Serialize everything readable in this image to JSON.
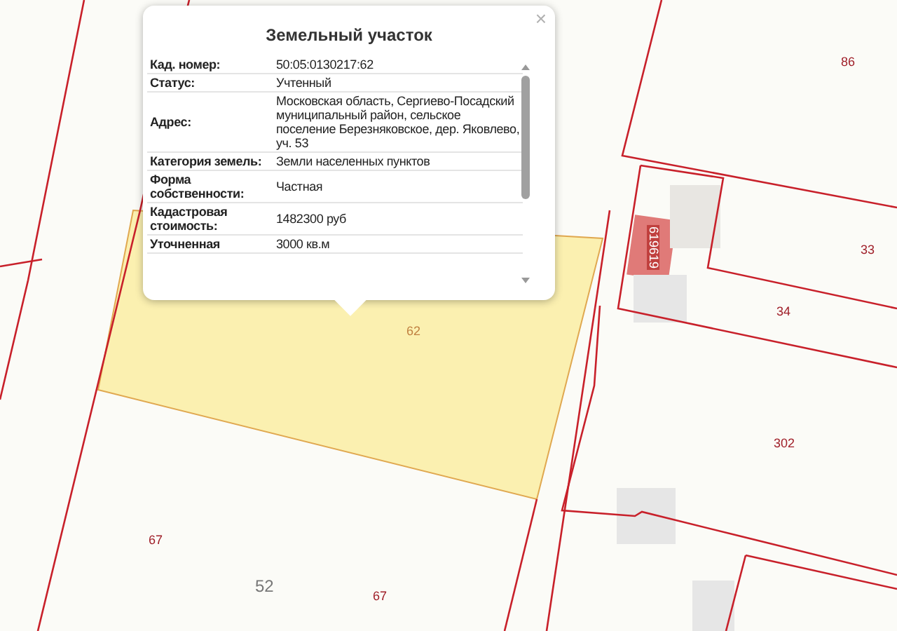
{
  "popup": {
    "title": "Земельный участок",
    "close": "×",
    "rows": [
      {
        "label": "Кад. номер:",
        "value": "50:05:0130217:62"
      },
      {
        "label": "Статус:",
        "value": "Учтенный"
      },
      {
        "label": "Адрес:",
        "value": "Московская область, Сергиево-Посадский муниципальный район, сельское поселение Березняковское, дер. Яковлево, уч. 53"
      },
      {
        "label": "Категория земель:",
        "value": "Земли населенных пунктов"
      },
      {
        "label": "Форма собственности:",
        "value": "Частная"
      },
      {
        "label": "Кадастровая стоимость:",
        "value": "1482300 руб"
      },
      {
        "label": "Уточненная",
        "value": "3000 кв.м"
      }
    ]
  },
  "map_labels": [
    {
      "text": "86",
      "kind": "parcel"
    },
    {
      "text": "33",
      "kind": "parcel"
    },
    {
      "text": "34",
      "kind": "parcel"
    },
    {
      "text": "302",
      "kind": "parcel"
    },
    {
      "text": "62",
      "kind": "selected"
    },
    {
      "text": "67",
      "kind": "parcel"
    },
    {
      "text": "52",
      "kind": "quarter"
    },
    {
      "text": "67",
      "kind": "parcel"
    },
    {
      "text": "619619",
      "kind": "building"
    }
  ]
}
